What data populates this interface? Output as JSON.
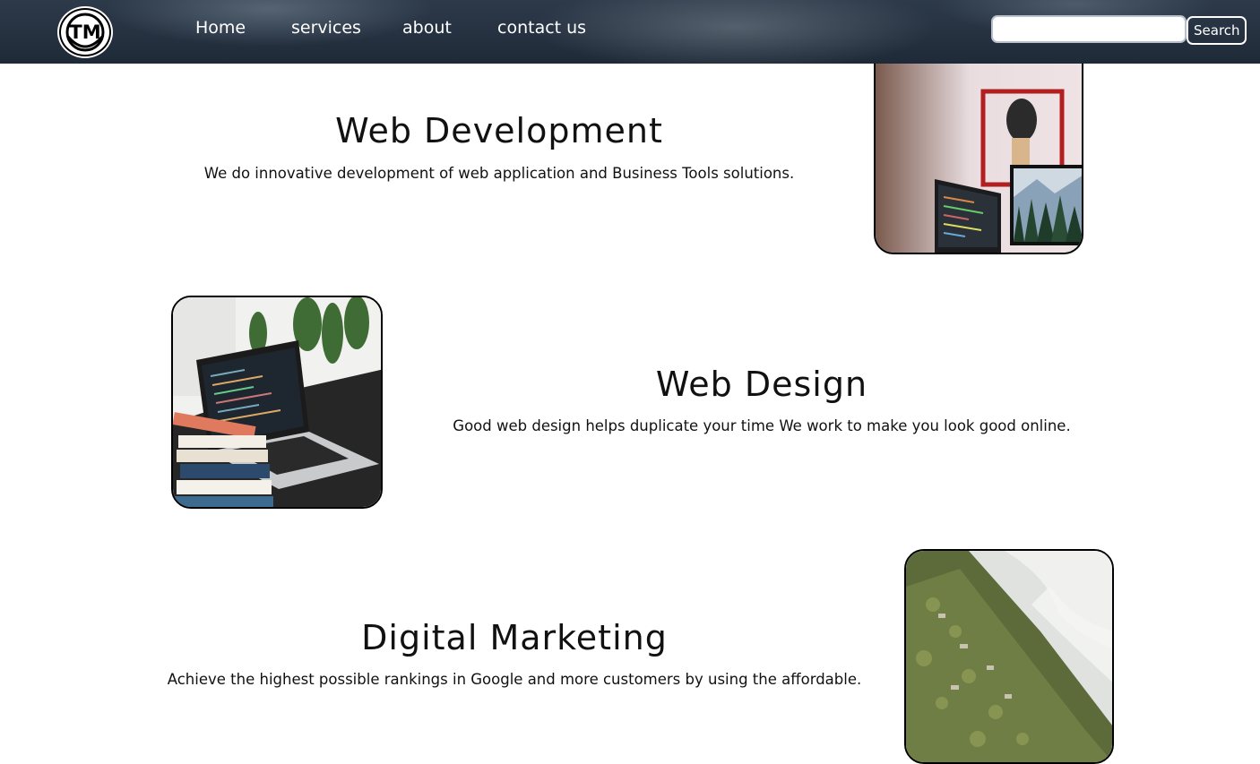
{
  "header": {
    "logo_text": "TM",
    "nav": [
      {
        "label": "Home"
      },
      {
        "label": "services"
      },
      {
        "label": "about"
      },
      {
        "label": "contact us"
      }
    ],
    "search": {
      "placeholder": "",
      "value": "",
      "button_label": "Search"
    }
  },
  "services": [
    {
      "title": "Web Development",
      "description": "We do innovative development of web application and Business Tools solutions.",
      "image_icon": "desk-monitors-photo"
    },
    {
      "title": "Web Design",
      "description": "Good web design helps duplicate your time We work to make you look good online.",
      "image_icon": "laptop-books-photo"
    },
    {
      "title": "Digital Marketing",
      "description": "Achieve the highest possible rankings in Google and more customers by using the affordable.",
      "image_icon": "misty-hillside-photo"
    }
  ]
}
